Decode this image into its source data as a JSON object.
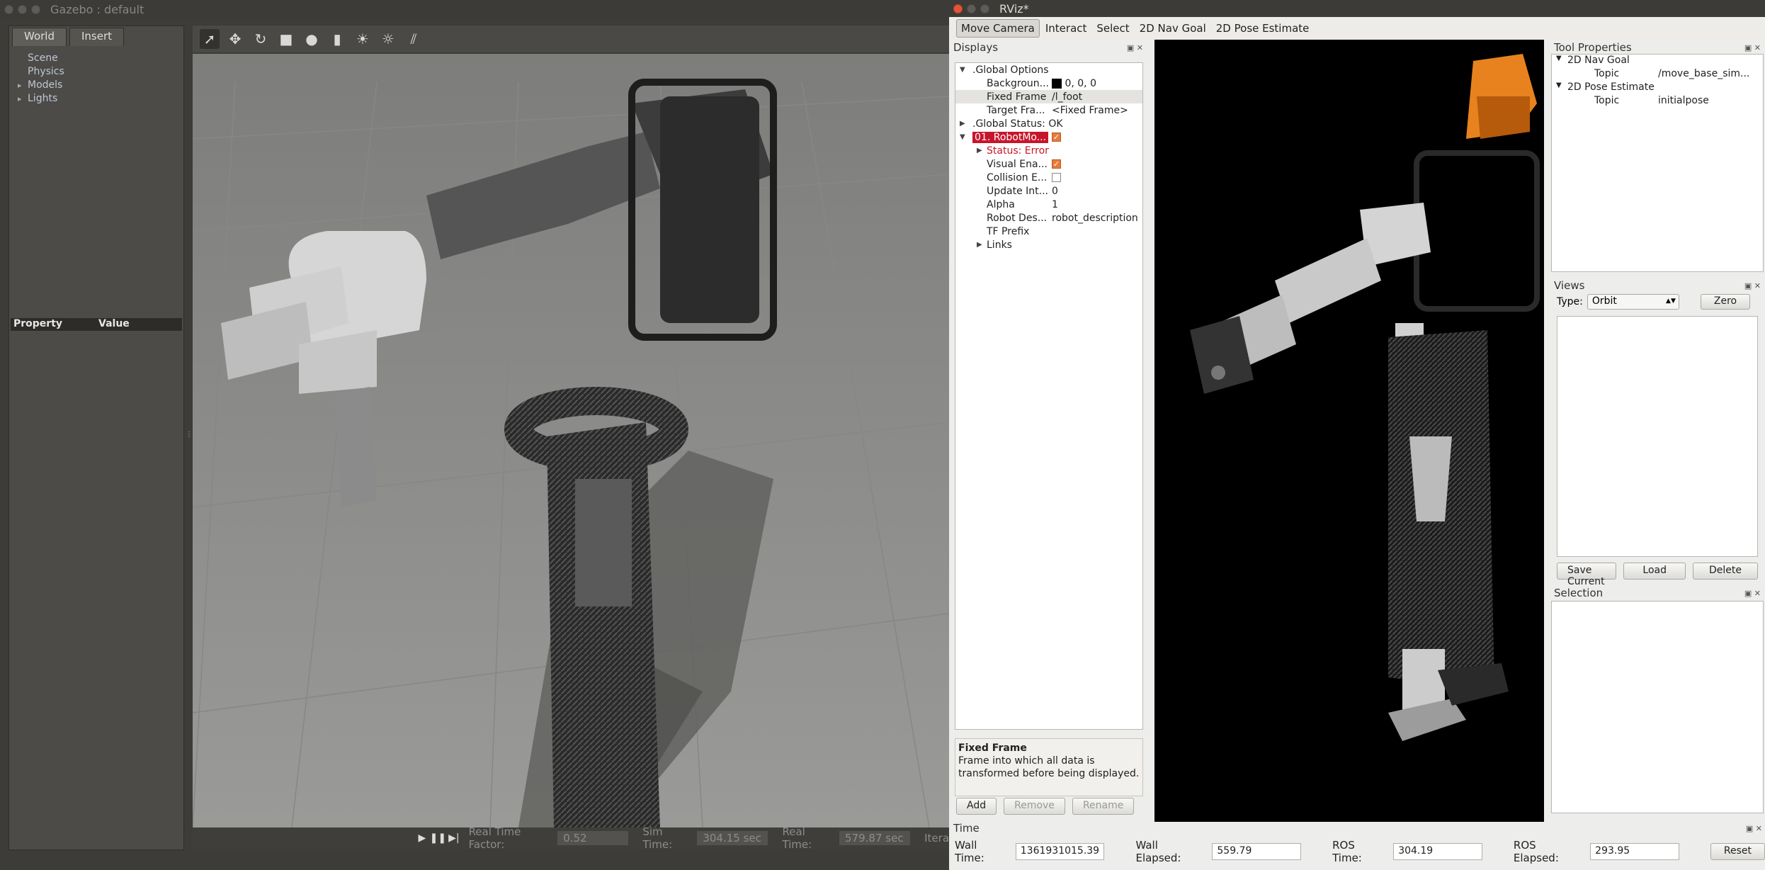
{
  "gazebo": {
    "title": "Gazebo : default",
    "tabs": [
      "World",
      "Insert"
    ],
    "tree": [
      {
        "label": "Scene",
        "expandable": false
      },
      {
        "label": "Physics",
        "expandable": false
      },
      {
        "label": "Models",
        "expandable": true
      },
      {
        "label": "Lights",
        "expandable": true
      }
    ],
    "prop_header": {
      "property": "Property",
      "value": "Value"
    },
    "status": {
      "rtf_label": "Real Time Factor:",
      "rtf": "0.52",
      "sim_label": "Sim Time:",
      "sim": "304.15 sec",
      "real_label": "Real Time:",
      "real": "579.87 sec",
      "iter_label": "Itera"
    }
  },
  "rviz": {
    "title": "RViz*",
    "tools": [
      "Move Camera",
      "Interact",
      "Select",
      "2D Nav Goal",
      "2D Pose Estimate"
    ],
    "displays_title": "Displays",
    "global_options": ".Global Options",
    "background_label": "Backgroun...",
    "background_value": "0, 0, 0",
    "fixed_frame_label": "Fixed Frame",
    "fixed_frame_value": "/l_foot",
    "target_frame_label": "Target Fra...",
    "target_frame_value": "<Fixed Frame>",
    "global_status": ".Global Status: OK",
    "robot_model": "01. RobotMo...",
    "status_error": "Status: Error",
    "visual_label": "Visual Ena...",
    "collision_label": "Collision E...",
    "update_label": "Update Int...",
    "update_value": "0",
    "alpha_label": "Alpha",
    "alpha_value": "1",
    "robot_desc_label": "Robot Des...",
    "robot_desc_value": "robot_description",
    "tf_prefix_label": "TF Prefix",
    "links_label": "Links",
    "desc_title": "Fixed Frame",
    "desc_text": "Frame into which all data is transformed before being displayed.",
    "buttons": {
      "add": "Add",
      "remove": "Remove",
      "rename": "Rename"
    },
    "tool_props_title": "Tool Properties",
    "nav_goal": "2D Nav Goal",
    "topic_label": "Topic",
    "nav_topic": "/move_base_sim...",
    "pose_est": "2D Pose Estimate",
    "pose_topic": "initialpose",
    "views_title": "Views",
    "type_label": "Type:",
    "type_value": "Orbit",
    "zero": "Zero",
    "save_current": "Save Current",
    "load": "Load",
    "delete": "Delete",
    "selection_title": "Selection",
    "time_title": "Time",
    "wall_time_label": "Wall Time:",
    "wall_time": "1361931015.39",
    "wall_elapsed_label": "Wall Elapsed:",
    "wall_elapsed": "559.79",
    "ros_time_label": "ROS Time:",
    "ros_time": "304.19",
    "ros_elapsed_label": "ROS Elapsed:",
    "ros_elapsed": "293.95",
    "reset": "Reset"
  }
}
